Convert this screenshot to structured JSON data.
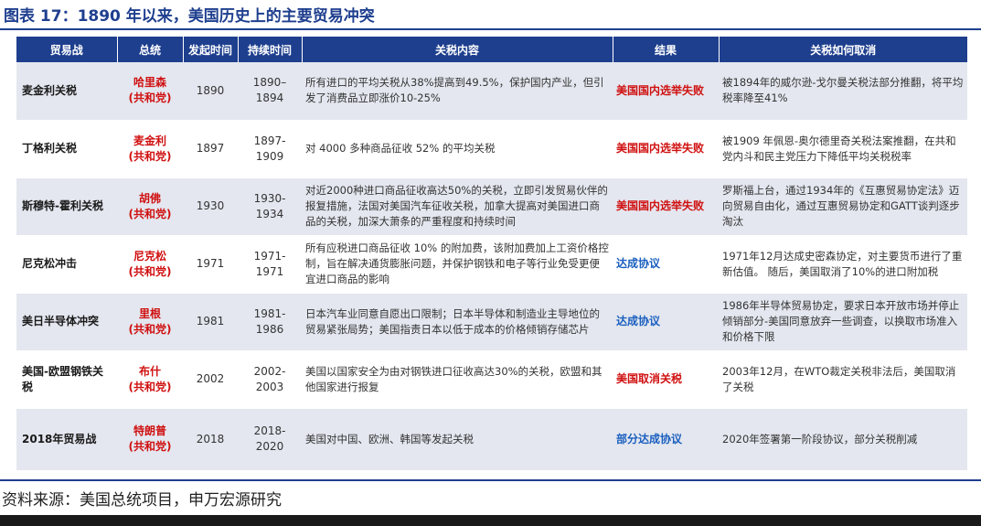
{
  "title": "图表 17：1890 年以来，美国历史上的主要贸易冲突",
  "columns": [
    "贸易战",
    "总统",
    "发起时间",
    "持续时间",
    "关税内容",
    "结果",
    "关税如何取消"
  ],
  "rows": [
    {
      "war": "麦金利关税",
      "president": "哈里森",
      "party": "(共和党)",
      "year": "1890",
      "duration": "1890–1894",
      "content": "所有进口的平均关税从38%提高到49.5%，保护国内产业，但引发了消费品立即涨价10-25%",
      "result": "美国国内选举失败",
      "result_color": "#d01010",
      "removal": "被1894年的威尔逊-戈尔曼关税法部分推翻，将平均税率降至41%"
    },
    {
      "war": "丁格利关税",
      "president": "麦金利",
      "party": "(共和党)",
      "year": "1897",
      "duration": "1897-1909",
      "content": "对 4000 多种商品征收 52% 的平均关税",
      "result": "美国国内选举失败",
      "result_color": "#d01010",
      "removal": "被1909 年佩恩-奥尔德里奇关税法案推翻，在共和党内斗和民主党压力下降低平均关税税率"
    },
    {
      "war": "斯穆特-霍利关税",
      "president": "胡佛",
      "party": "(共和党)",
      "year": "1930",
      "duration": "1930-1934",
      "content": "对近2000种进口商品征收高达50%的关税，立即引发贸易伙伴的报复措施，法国对美国汽车征收关税，加拿大提高对美国进口商品的关税，加深大萧条的严重程度和持续时间",
      "result": "美国国内选举失败",
      "result_color": "#d01010",
      "removal": "罗斯福上台，通过1934年的《互惠贸易协定法》迈向贸易自由化，通过互惠贸易协定和GATT谈判逐步淘汰"
    },
    {
      "war": "尼克松冲击",
      "president": "尼克松",
      "party": "(共和党)",
      "year": "1971",
      "duration": "1971-1971",
      "content": "所有应税进口商品征收 10% 的附加费，该附加费加上工资价格控制，旨在解决通货膨胀问题，并保护钢铁和电子等行业免受更便宜进口商品的影响",
      "result": "达成协议",
      "result_color": "#1a5fbf",
      "removal": "1971年12月达成史密森协定，对主要货币进行了重新估值。 随后，美国取消了10%的进口附加税"
    },
    {
      "war": "美日半导体冲突",
      "president": "里根",
      "party": "(共和党)",
      "year": "1981",
      "duration": "1981-1986",
      "content": "日本汽车业同意自愿出口限制；日本半导体和制造业主导地位的贸易紧张局势；美国指责日本以低于成本的价格倾销存储芯片",
      "result": "达成协议",
      "result_color": "#1a5fbf",
      "removal": "1986年半导体贸易协定，要求日本开放市场并停止倾销部分-美国同意放弃一些调查，以换取市场准入和价格下限"
    },
    {
      "war": "美国-欧盟钢铁关税",
      "president": "布什",
      "party": "(共和党)",
      "year": "2002",
      "duration": "2002-2003",
      "content": "美国以国家安全为由对钢铁进口征收高达30%的关税，欧盟和其他国家进行报复",
      "result": "美国取消关税",
      "result_color": "#d01010",
      "removal": "2003年12月，在WTO裁定关税非法后，美国取消了关税"
    },
    {
      "war": "2018年贸易战",
      "president": "特朗普",
      "party": "(共和党)",
      "year": "2018",
      "duration": "2018-2020",
      "content": "美国对中国、欧洲、韩国等发起关税",
      "result": "部分达成协议",
      "result_color": "#1a5fbf",
      "removal": "2020年签署第一阶段协议，部分关税削减"
    }
  ],
  "source": "资料来源：美国总统项目，申万宏源研究"
}
